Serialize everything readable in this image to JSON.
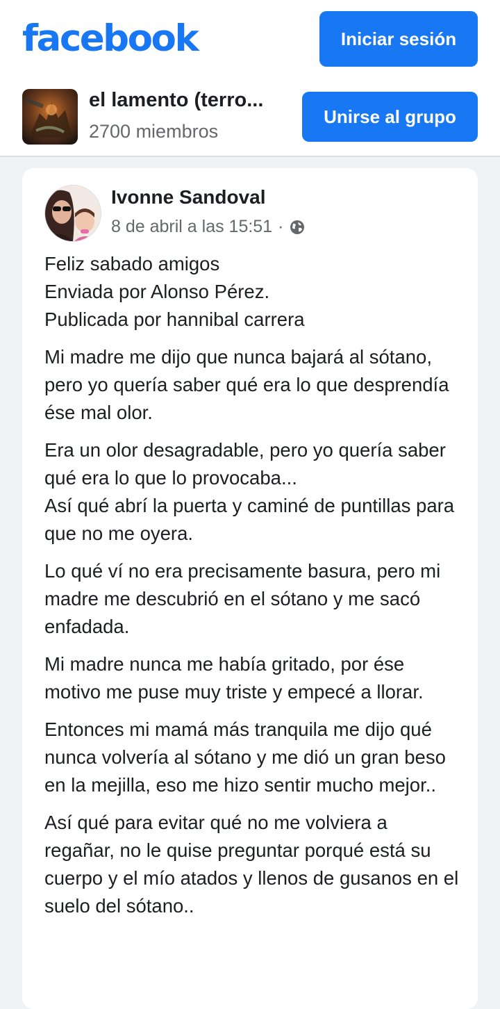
{
  "header": {
    "logo_text": "facebook",
    "login_label": "Iniciar sesión"
  },
  "group": {
    "name": "el lamento (terro...",
    "members": "2700 miembros",
    "join_label": "Unirse al grupo"
  },
  "post": {
    "author": "Ivonne Sandoval",
    "date": "8 de abril a las 15:51",
    "separator": "·",
    "privacy_icon": "globe-icon",
    "paragraphs": [
      "Feliz sabado amigos\nEnviada por Alonso Pérez.\nPublicada  por hannibal carrera",
      "Mi madre me dijo que nunca bajará al sótano, pero yo quería saber qué era lo que desprendía ése mal olor.",
      "Era un olor desagradable, pero yo quería saber qué era lo que lo provocaba...\nAsí qué abrí la puerta y caminé de puntillas para que no me oyera.",
      " Lo qué ví no era precisamente basura, pero mi madre me descubrió en el sótano y me sacó enfadada.",
      "Mi madre nunca me había gritado, por ése motivo me puse muy triste y empecé a llorar.",
      "Entonces mi mamá más tranquila me dijo qué nunca volvería al sótano y me dió un gran beso en la mejilla, eso me hizo sentir mucho mejor..",
      "Así qué para evitar qué no me volviera a regañar, no le quise preguntar porqué está su cuerpo y el mío atados y llenos de gusanos en el suelo del sótano.."
    ]
  },
  "colors": {
    "brand": "#1877f2",
    "background": "#f0f2f5",
    "secondary_text": "#65676b"
  }
}
